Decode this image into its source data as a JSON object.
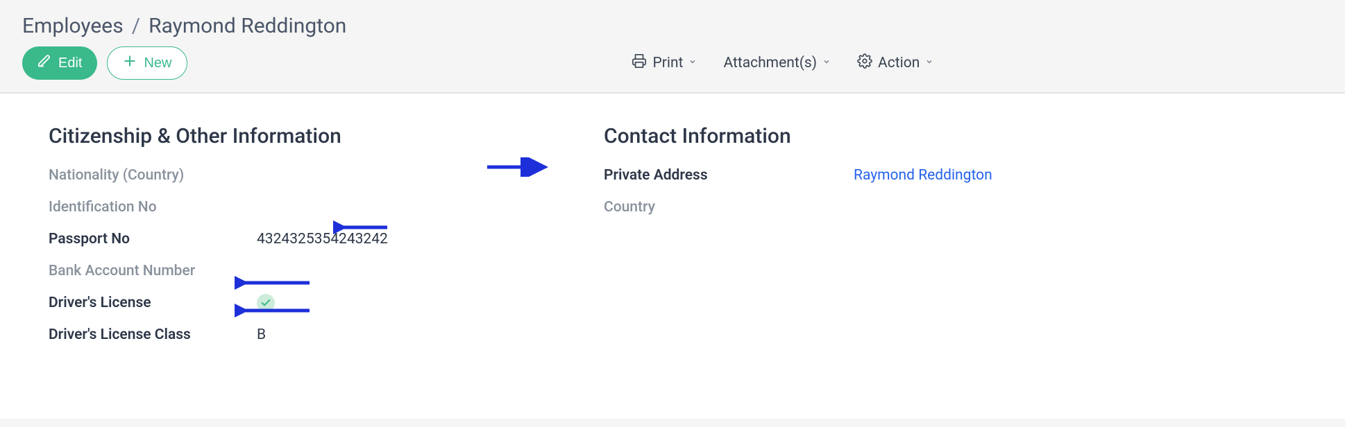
{
  "breadcrumb": {
    "root": "Employees",
    "current": "Raymond Reddington"
  },
  "buttons": {
    "edit": "Edit",
    "new": "New"
  },
  "toolbar": {
    "print": "Print",
    "attachments": "Attachment(s)",
    "action": "Action"
  },
  "sections": {
    "citizenship": {
      "title": "Citizenship & Other Information",
      "fields": {
        "nationality": {
          "label": "Nationality (Country)",
          "value": ""
        },
        "identification": {
          "label": "Identification No",
          "value": ""
        },
        "passport": {
          "label": "Passport No",
          "value": "4324325354243242"
        },
        "bank": {
          "label": "Bank Account Number",
          "value": ""
        },
        "drivers_license": {
          "label": "Driver's License",
          "checked": true
        },
        "drivers_license_class": {
          "label": "Driver's License Class",
          "value": "B"
        }
      }
    },
    "contact": {
      "title": "Contact Information",
      "fields": {
        "private_address": {
          "label": "Private Address",
          "value": "Raymond Reddington"
        },
        "country": {
          "label": "Country",
          "value": ""
        }
      }
    }
  }
}
